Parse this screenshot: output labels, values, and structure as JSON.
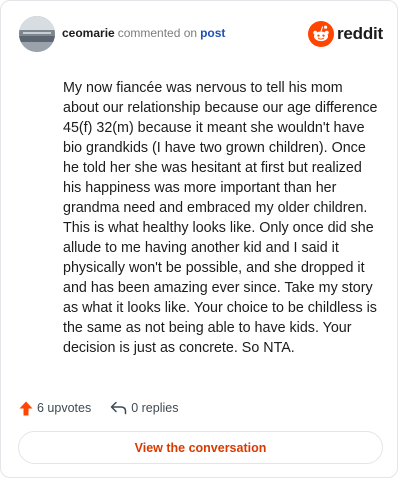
{
  "header": {
    "username": "ceomarie",
    "action_text": "commented on",
    "post_link": "post",
    "brand_name": "reddit"
  },
  "comment": {
    "text": "My now fiancée was nervous to tell his mom about our relationship because our age difference 45(f) 32(m) because it meant she wouldn't have bio grandkids (I have two grown children). Once he told her she was hesitant at first but realized his happiness was more important than her grandma need and embraced my older children. This is what healthy looks like. Only once did she allude to me having another kid and I said it physically won't be possible, and she dropped it and has been amazing ever since. Take my story as what it looks like. Your choice to be childless is the same as not being able to have kids. Your decision is just as concrete. So NTA."
  },
  "footer": {
    "upvotes_label": "6 upvotes",
    "replies_label": "0 replies",
    "conversation_button": "View the conversation"
  },
  "colors": {
    "brand_orange": "#ff4500",
    "link_blue": "#1f4fb5",
    "button_text": "#d93a00",
    "muted_text": "#7c7c7c"
  },
  "icons": {
    "upvote": "upvote-arrow-icon",
    "reply": "reply-arrow-icon",
    "brand": "reddit-logo-icon"
  }
}
